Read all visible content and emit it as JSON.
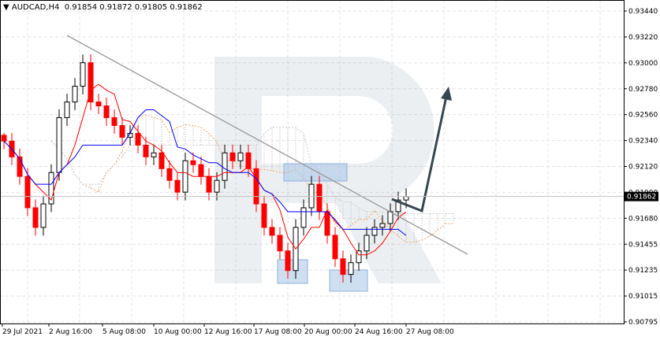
{
  "header": {
    "symbol": "AUDCAD,H4",
    "open": "0.91854",
    "high": "0.91872",
    "low": "0.91805",
    "close": "0.91862"
  },
  "colors": {
    "bull": "#228b22",
    "bear": "#ff0000",
    "tenkan": "#ff0000",
    "kijun": "#0000ff",
    "cloud": "#b0b0b0",
    "trend": "#999999",
    "arrow": "#37474f",
    "box": "#a8c4e8"
  },
  "chart_data": {
    "type": "candlestick",
    "symbol": "AUDCAD",
    "timeframe": "H4",
    "ylim": [
      0.90795,
      0.9344
    ],
    "yticks": [
      "0.93440",
      "0.93220",
      "0.93000",
      "0.92780",
      "0.92560",
      "0.92340",
      "0.92120",
      "0.91900",
      "0.91680",
      "0.91455",
      "0.91235",
      "0.91015",
      "0.90795"
    ],
    "xticks": [
      "29 Jul 2021",
      "2 Aug 16:00",
      "5 Aug 08:00",
      "10 Aug 00:00",
      "12 Aug 16:00",
      "17 Aug 08:00",
      "20 Aug 00:00",
      "24 Aug 16:00",
      "27 Aug 08:00"
    ],
    "current_price": "0.91862",
    "closes": [
      0.92333,
      0.92199,
      0.92033,
      0.91766,
      0.91599,
      0.91799,
      0.92066,
      0.92533,
      0.92666,
      0.928,
      0.93,
      0.92666,
      0.92633,
      0.92533,
      0.92466,
      0.92366,
      0.92399,
      0.92299,
      0.92199,
      0.92233,
      0.92099,
      0.91999,
      0.91899,
      0.92166,
      0.92133,
      0.92033,
      0.91899,
      0.91999,
      0.92233,
      0.92166,
      0.92233,
      0.92099,
      0.91799,
      0.91599,
      0.91532,
      0.91399,
      0.91232,
      0.91599,
      0.91766,
      0.91966,
      0.91733,
      0.91532,
      0.91332,
      0.91199,
      0.91299,
      0.91399,
      0.91532,
      0.91599,
      0.91632,
      0.91733,
      0.91832,
      0.91862
    ],
    "indicators": [
      "Ichimoku Kinko Hyo"
    ],
    "annotations": [
      "descending trendline",
      "forecast arrow up",
      "support/resistance boxes"
    ]
  }
}
